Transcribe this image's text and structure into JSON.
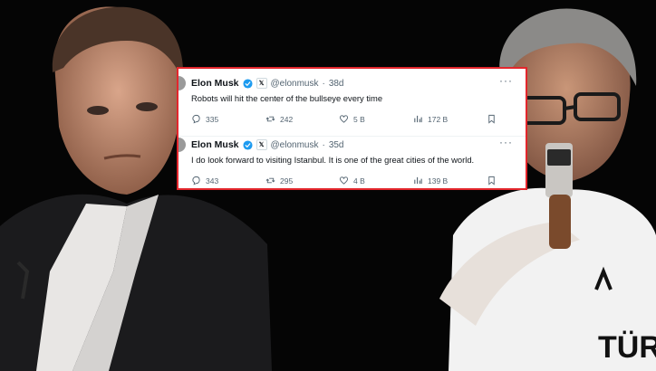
{
  "accent_color": "#e3262c",
  "verified_color": "#1d9bf0",
  "tweets": [
    {
      "name": "Elon Musk",
      "handle": "@elonmusk",
      "dot": "·",
      "age": "38d",
      "more": "···",
      "text": "Robots will hit the center of the bullseye every time",
      "replies": "335",
      "retweets": "242",
      "likes": "5 B",
      "views": "172 B"
    },
    {
      "name": "Elon Musk",
      "handle": "@elonmusk",
      "dot": "·",
      "age": "35d",
      "more": "···",
      "text": "I do look forward to visiting Istanbul. It is one of the great cities of the world.",
      "replies": "343",
      "retweets": "295",
      "likes": "4 B",
      "views": "139 B"
    }
  ],
  "icons": [
    "verified-icon",
    "x-logo-icon",
    "reply-icon",
    "retweet-icon",
    "like-icon",
    "views-icon",
    "bookmark-icon"
  ],
  "jersey_text": "TÜR"
}
